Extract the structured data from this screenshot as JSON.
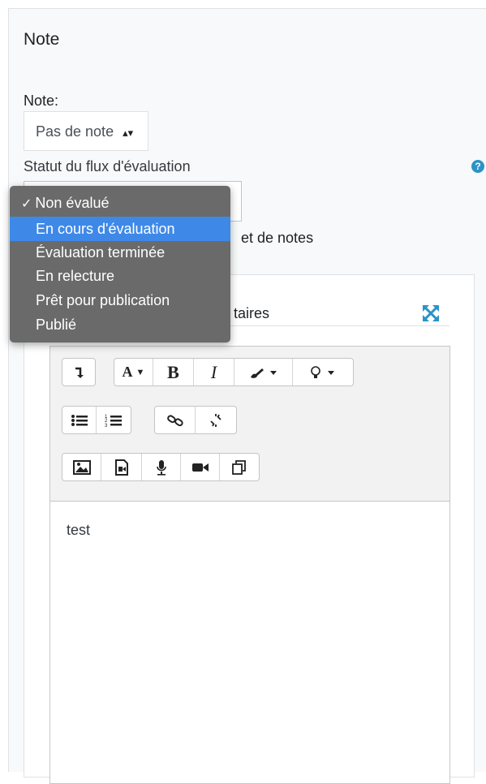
{
  "section": {
    "title": "Note"
  },
  "grade": {
    "label": "Note:",
    "value": "Pas de note",
    "arrow": "⬍"
  },
  "workflow": {
    "label": "Statut du flux d'évaluation",
    "help": "?",
    "options": [
      {
        "check": "✓",
        "label": "Non évalué"
      },
      {
        "label": "En cours d'évaluation"
      },
      {
        "label": "Évaluation terminée"
      },
      {
        "label": "En relecture"
      },
      {
        "label": "Prêt pour publication"
      },
      {
        "label": "Publié"
      }
    ]
  },
  "notify": {
    "label_fragment": "et de notes"
  },
  "feedback": {
    "label_fragment": "taires",
    "editor": {
      "content": "test",
      "toolbar": {
        "row1": [
          {
            "name": "collapse-icon",
            "text": "↴"
          },
          {
            "name": "font-icon",
            "text": "A▾"
          },
          {
            "name": "bold-icon",
            "text": "B"
          },
          {
            "name": "italic-icon",
            "text": "I"
          },
          {
            "name": "paint-brush-icon"
          },
          {
            "name": "lightbulb-icon"
          }
        ]
      }
    }
  }
}
